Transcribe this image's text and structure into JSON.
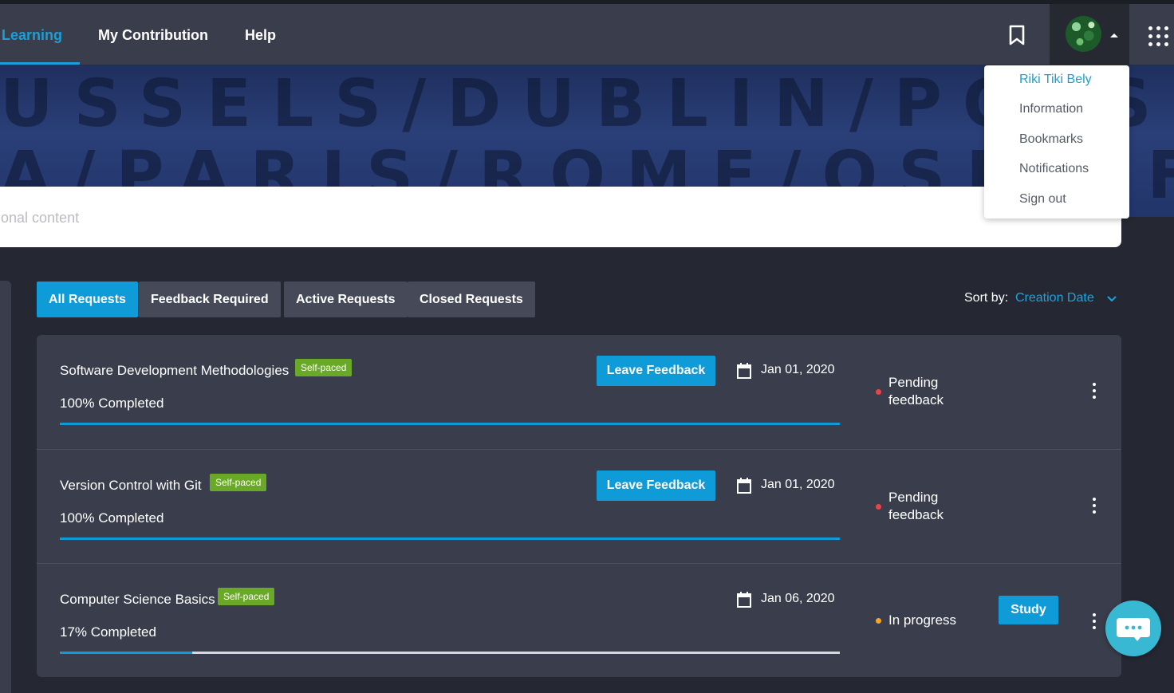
{
  "nav": {
    "items": [
      {
        "label": "Learning",
        "active": true
      },
      {
        "label": "My Contribution",
        "active": false
      },
      {
        "label": "Help",
        "active": false
      }
    ]
  },
  "header_icons": {
    "bookmark": "bookmark-icon",
    "apps": "apps-grid-icon"
  },
  "banner": {
    "row1": "USSELS/DUBLIN/POTSDAM/BR",
    "row2": "A/PARIS/ROME/OSLO/FF/MAR"
  },
  "search": {
    "placeholder": "itional content"
  },
  "tabs": [
    {
      "label": "All Requests",
      "active": true
    },
    {
      "label": "Feedback Required",
      "active": false
    },
    {
      "label": "Active Requests",
      "active": false
    },
    {
      "label": "Closed Requests",
      "active": false
    }
  ],
  "sort": {
    "label": "Sort by:",
    "value": "Creation Date"
  },
  "requests": [
    {
      "title": "Software Development Methodologies",
      "badge": "Self-paced",
      "completed_label": "100% Completed",
      "progress": 1.0,
      "action": "Leave Feedback",
      "date": "Jan 01, 2020",
      "status": "Pending feedback",
      "status_color": "#e84545"
    },
    {
      "title": "Version Control with Git",
      "badge": "Self-paced",
      "completed_label": "100% Completed",
      "progress": 1.0,
      "action": "Leave Feedback",
      "date": "Jan 01, 2020",
      "status": "Pending feedback",
      "status_color": "#e84545"
    },
    {
      "title": "Computer Science Basics",
      "badge": "Self-paced",
      "completed_label": "17% Completed",
      "progress": 0.17,
      "action": "Study",
      "date": "Jan 06, 2020",
      "status": "In progress",
      "status_color": "#f5a623"
    }
  ],
  "user_menu": {
    "user_name": "Riki Tiki Bely",
    "items": [
      "Information",
      "Bookmarks",
      "Notifications",
      "Sign out"
    ]
  },
  "colors": {
    "accent": "#0f9bd7",
    "badge": "#6aa827",
    "navbar": "#3a3d4b",
    "page_bg": "#252832"
  }
}
